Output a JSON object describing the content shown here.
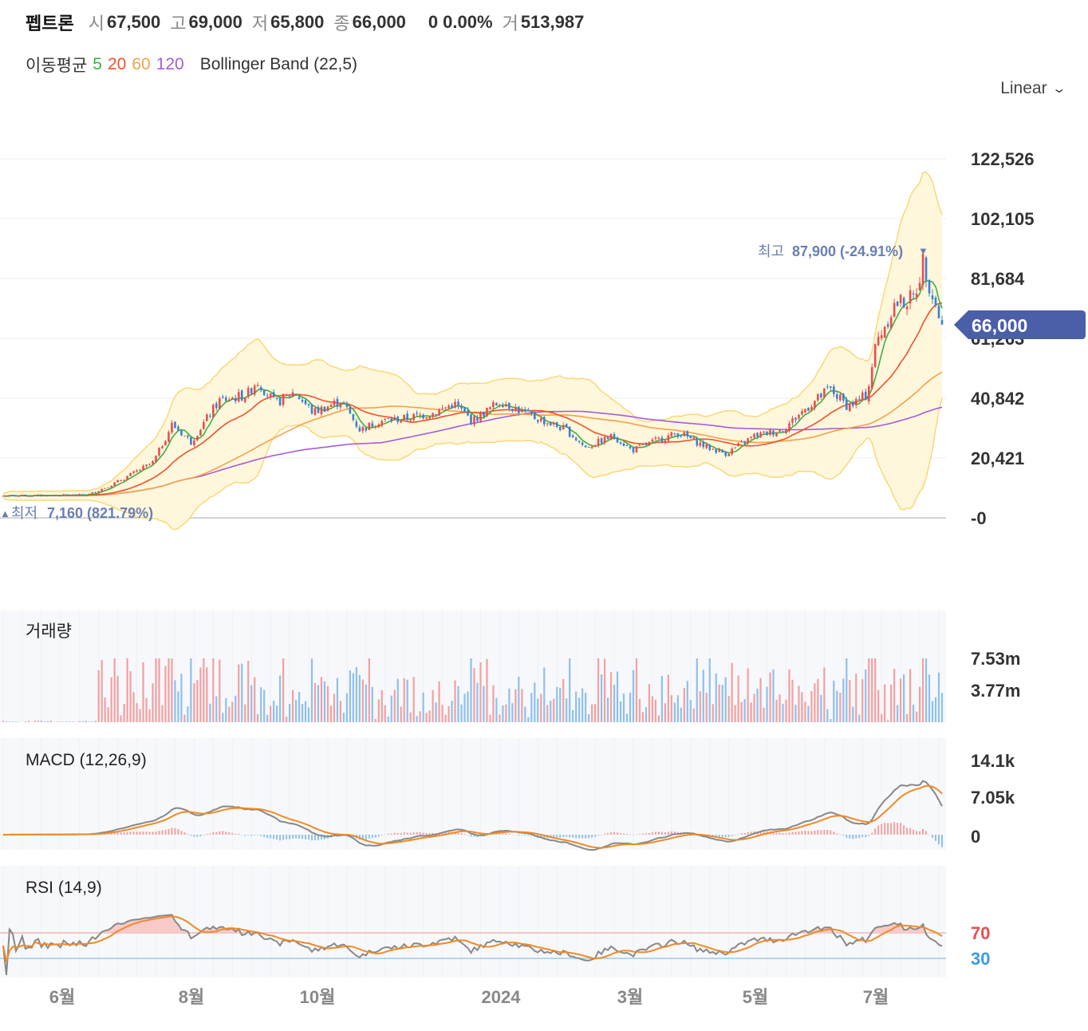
{
  "header": {
    "name": "펩트론",
    "open_label": "시",
    "open": "67,500",
    "high_label": "고",
    "high": "69,000",
    "low_label": "저",
    "low": "65,800",
    "close_label": "종",
    "close": "66,000",
    "change": "0",
    "change_pct": "0.00%",
    "volume_label": "거",
    "volume": "513,987"
  },
  "indicators": {
    "ma_label": "이동평균",
    "ma_periods": [
      "5",
      "20",
      "60",
      "120"
    ],
    "ma_colors": [
      "#3cb043",
      "#f0502d",
      "#f5a04a",
      "#a55cd8"
    ],
    "bollinger_label": "Bollinger Band (22,5)"
  },
  "scale_selector": {
    "value": "Linear"
  },
  "annotations": {
    "high_label": "최고",
    "high_text": "87,900 (-24.91%)",
    "low_label": "최저",
    "low_text": "7,160 (821.79%)"
  },
  "current_price_tag": "66,000",
  "colors": {
    "up": "#e94d4d",
    "down": "#3d7fd1",
    "bollinger_fill": "#fff7dc",
    "bollinger_line": "#f8d876",
    "price_tag": "#4a5fa8",
    "macd_line": "#888888",
    "signal_line": "#f08a24",
    "rsi_70": "#e94d4d",
    "rsi_30": "#3d9be0"
  },
  "chart_data": [
    {
      "type": "candlestick",
      "title": "",
      "y_axis_ticks": [
        "122,526",
        "102,105",
        "81,684",
        "61,263",
        "40,842",
        "20,421",
        "-0"
      ],
      "ylim": [
        -20000,
        130000
      ],
      "x_axis_ticks": [
        "6월",
        "8월",
        "10월",
        "2024",
        "3월",
        "5월",
        "7월"
      ],
      "series_summary": {
        "start_price": 7500,
        "all_time_low": 7160,
        "all_time_high": 87900,
        "last_close": 66000
      },
      "price_path": [
        [
          0,
          7500
        ],
        [
          0.09,
          7800
        ],
        [
          0.12,
          12000
        ],
        [
          0.16,
          19000
        ],
        [
          0.18,
          32000
        ],
        [
          0.2,
          26000
        ],
        [
          0.23,
          40000
        ],
        [
          0.26,
          42000
        ],
        [
          0.27,
          47000
        ],
        [
          0.29,
          39000
        ],
        [
          0.31,
          43000
        ],
        [
          0.33,
          36000
        ],
        [
          0.36,
          40000
        ],
        [
          0.38,
          30000
        ],
        [
          0.4,
          33000
        ],
        [
          0.43,
          34000
        ],
        [
          0.46,
          36000
        ],
        [
          0.48,
          39000
        ],
        [
          0.5,
          33000
        ],
        [
          0.53,
          40000
        ],
        [
          0.56,
          35000
        ],
        [
          0.6,
          30000
        ],
        [
          0.62,
          24000
        ],
        [
          0.65,
          28000
        ],
        [
          0.67,
          23000
        ],
        [
          0.7,
          27000
        ],
        [
          0.72,
          29000
        ],
        [
          0.75,
          24000
        ],
        [
          0.77,
          22000
        ],
        [
          0.8,
          28000
        ],
        [
          0.83,
          30000
        ],
        [
          0.85,
          36000
        ],
        [
          0.88,
          44000
        ],
        [
          0.9,
          38000
        ],
        [
          0.92,
          42000
        ],
        [
          0.93,
          60000
        ],
        [
          0.95,
          73000
        ],
        [
          0.97,
          75000
        ],
        [
          0.98,
          87900
        ],
        [
          0.99,
          76000
        ],
        [
          1,
          66000
        ]
      ]
    },
    {
      "type": "bar",
      "title": "거래량",
      "y_axis_ticks": [
        "7.53m",
        "3.77m"
      ]
    },
    {
      "type": "line",
      "title": "MACD (12,26,9)",
      "y_axis_ticks": [
        "14.1k",
        "7.05k",
        "0"
      ]
    },
    {
      "type": "line",
      "title": "RSI (14,9)",
      "y_axis_ticks": [
        "70",
        "30"
      ]
    }
  ]
}
